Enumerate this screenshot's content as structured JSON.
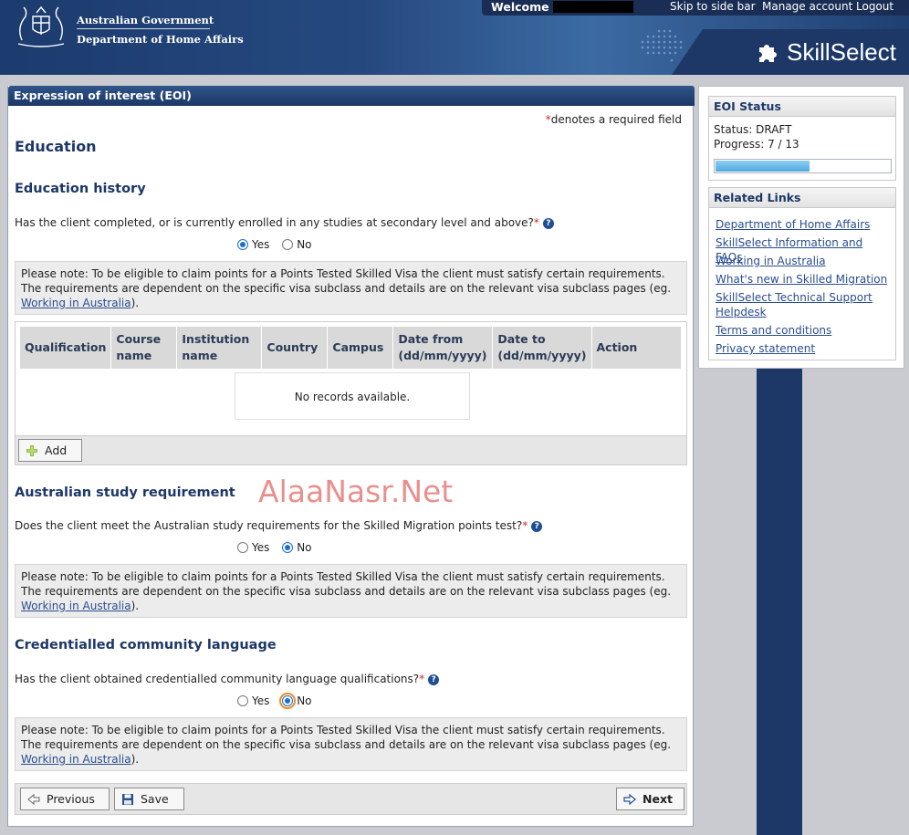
{
  "header": {
    "gov_line1": "Australian Government",
    "gov_line2": "Department of Home Affairs",
    "welcome": "Welcome E",
    "skip_link": "Skip to side bar",
    "manage_account": "Manage account",
    "logout": "Logout",
    "brand": "SkillSelect",
    "brand_icon": "puzzle-icon",
    "crest_icon": "coat-of-arms-icon"
  },
  "main": {
    "title": "Expression of interest (EOI)",
    "required_note": "denotes a required field",
    "section_title": "Education",
    "education_history": {
      "heading": "Education history",
      "question": "Has the client completed, or is currently enrolled in any studies at secondary level and above?",
      "options": [
        "Yes",
        "No"
      ],
      "selected": "Yes"
    },
    "note_text": "Please note: To be eligible to claim points for a Points Tested Skilled Visa the client must satisfy certain requirements. The requirements are dependent on the specific visa subclass and details are on the relevant visa subclass pages (eg.",
    "note_link": "Working in Australia",
    "note_tail": ").",
    "table": {
      "columns": [
        "Qualification",
        "Course name",
        "Institution name",
        "Country",
        "Campus",
        "Date from (dd/mm/yyyy)",
        "Date to (dd/mm/yyyy)",
        "Action"
      ],
      "empty_message": "No records available.",
      "add_label": "Add"
    },
    "study_requirement": {
      "heading": "Australian study requirement",
      "question": "Does the client meet the Australian study requirements for the Skilled Migration points test?",
      "options": [
        "Yes",
        "No"
      ],
      "selected": "No"
    },
    "community_language": {
      "heading": "Credentialled community language",
      "question": "Has the client obtained credentialled community language qualifications?",
      "options": [
        "Yes",
        "No"
      ],
      "selected": "No"
    },
    "nav": {
      "previous": "Previous",
      "save": "Save",
      "next": "Next"
    },
    "watermark": "AlaaNasr.Net"
  },
  "sidebar": {
    "status_heading": "EOI Status",
    "status_line": "Status: DRAFT",
    "progress_line": "Progress: 7 / 13",
    "progress_fraction": 0.538,
    "links_heading": "Related Links",
    "links": [
      "Department of Home Affairs",
      "SkillSelect Information and FAQs",
      "Working in Australia",
      "What's new in Skilled Migration",
      "SkillSelect Technical Support Helpdesk",
      "Terms and conditions",
      "Privacy statement"
    ]
  }
}
